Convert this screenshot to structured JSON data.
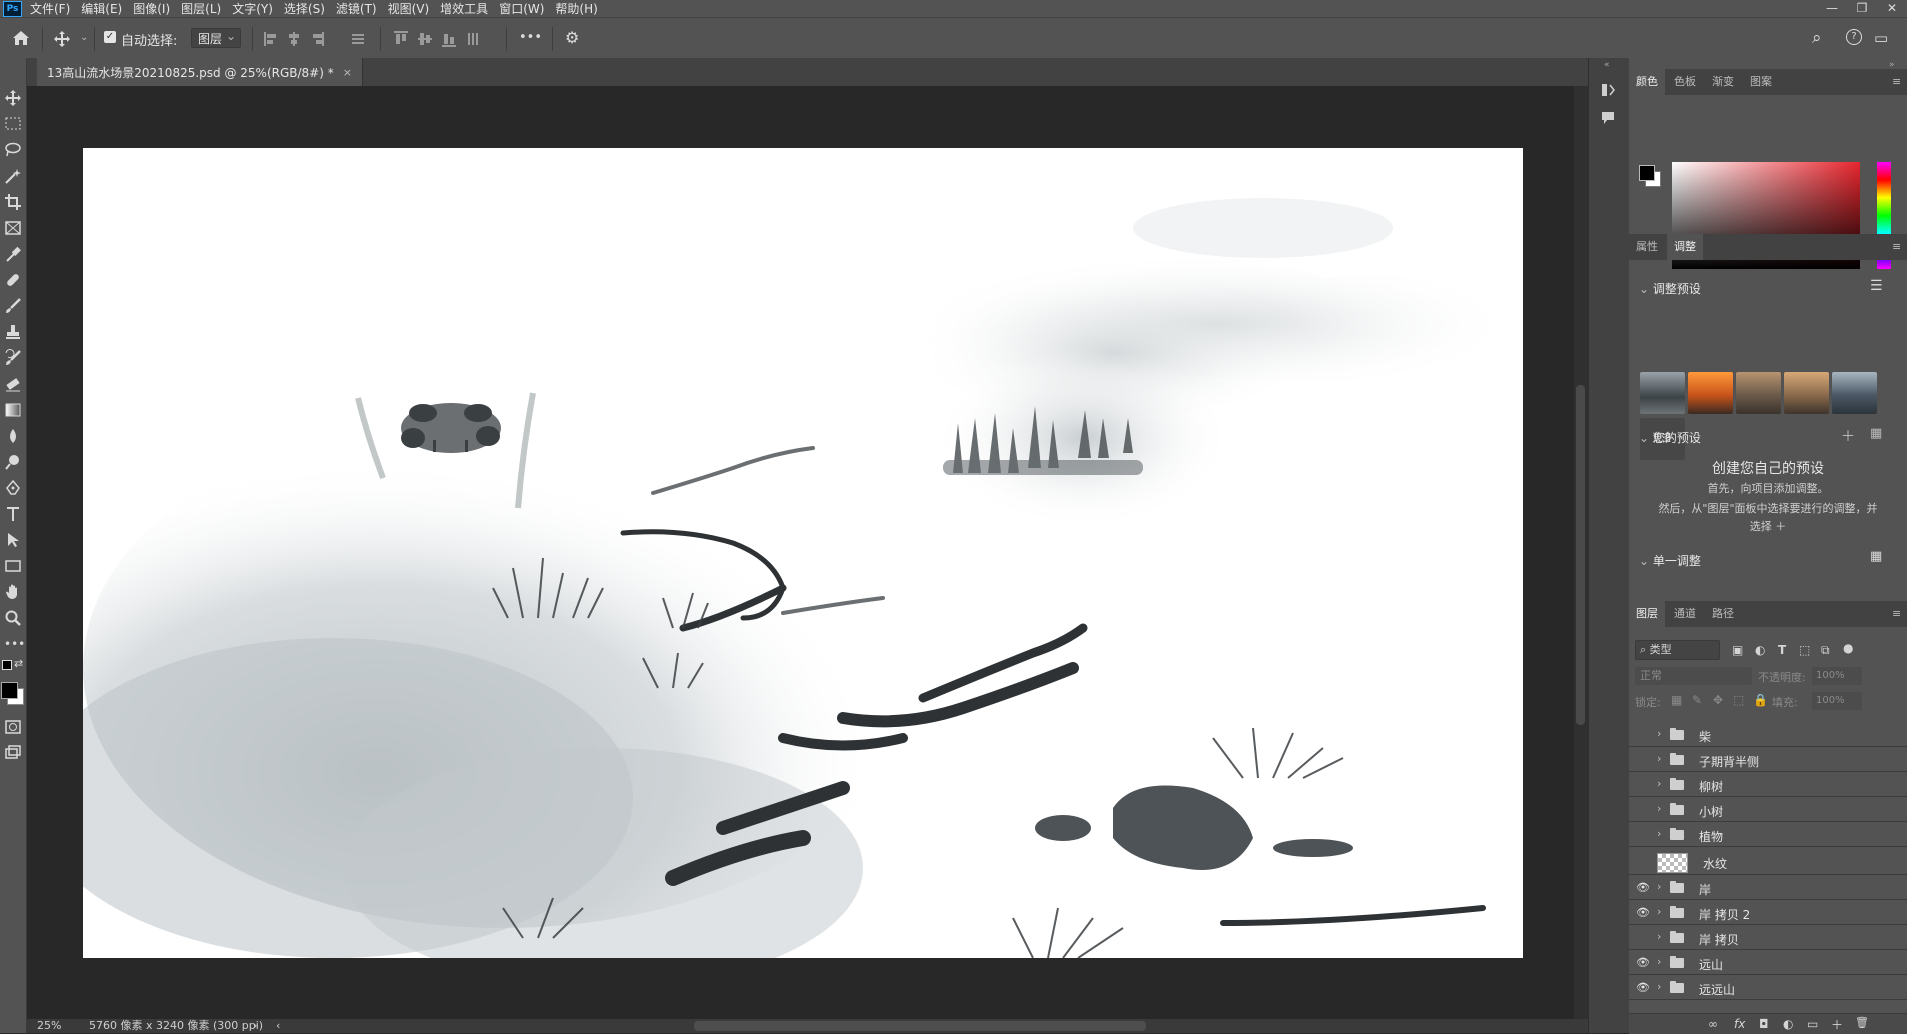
{
  "app": {
    "logo": "Ps"
  },
  "menu": [
    "文件(F)",
    "编辑(E)",
    "图像(I)",
    "图层(L)",
    "文字(Y)",
    "选择(S)",
    "滤镜(T)",
    "视图(V)",
    "增效工具",
    "窗口(W)",
    "帮助(H)"
  ],
  "window_controls": {
    "minimize": "—",
    "restore": "❐",
    "close": "✕"
  },
  "options": {
    "home_icon": "home-icon",
    "move_icon": "move-icon",
    "auto_select_label": "自动选择:",
    "auto_select_checked": true,
    "auto_select_check": "✓",
    "layer_mode": "图层",
    "more": "•••",
    "gear": "⚙",
    "search": "⌕",
    "help": "?",
    "workspace": "▭"
  },
  "document_tab": {
    "title": "13高山流水场景20210825.psd @ 25%(RGB/8#) *",
    "close": "×"
  },
  "status": {
    "zoom": "25%",
    "info": "5760 像素 x 3240 像素 (300 ppi)",
    "arrow": "›",
    "left_arrow": "‹"
  },
  "color_panel": {
    "tabs": [
      "颜色",
      "色板",
      "渐变",
      "图案"
    ],
    "active_tab": "颜色",
    "foreground": "#000000",
    "background": "#ffffff",
    "hue_color": "#e8262e"
  },
  "adjust_panel": {
    "tabs": [
      "属性",
      "调整"
    ],
    "active_tab": "调整",
    "presets_header": "调整预设",
    "more_label": "更多",
    "your_presets_header": "您的预设",
    "create_title": "创建您自己的预设",
    "create_line1": "首先，向项目添加调整。",
    "create_line2": "然后，从\"图层\"面板中选择要进行的调整，并",
    "create_line3": "选择 ＋",
    "single_header": "单一调整"
  },
  "layers_panel": {
    "tabs": [
      "图层",
      "通道",
      "路径"
    ],
    "active_tab": "图层",
    "filter_label": "类型",
    "blend_mode": "正常",
    "opacity_label": "不透明度:",
    "opacity_value": "100%",
    "lock_label": "锁定:",
    "fill_label": "填充:",
    "fill_value": "100%",
    "layers": [
      {
        "name": "柴",
        "visible": false,
        "type": "group"
      },
      {
        "name": "子期背半侧",
        "visible": false,
        "type": "group"
      },
      {
        "name": "柳树",
        "visible": false,
        "type": "group"
      },
      {
        "name": "小树",
        "visible": false,
        "type": "group"
      },
      {
        "name": "植物",
        "visible": false,
        "type": "group"
      },
      {
        "name": "水纹",
        "visible": false,
        "type": "layer"
      },
      {
        "name": "岸",
        "visible": true,
        "type": "group"
      },
      {
        "name": "岸 拷贝 2",
        "visible": true,
        "type": "group"
      },
      {
        "name": "岸 拷贝",
        "visible": false,
        "type": "group"
      },
      {
        "name": "远山",
        "visible": true,
        "type": "group"
      },
      {
        "name": "远远山",
        "visible": true,
        "type": "group"
      }
    ],
    "footer_icons": [
      "∞",
      "fx",
      "◘",
      "◐",
      "▭",
      "＋",
      "🗑"
    ]
  },
  "tools": [
    "move-tool",
    "marquee-tool",
    "lasso-tool",
    "magic-wand-tool",
    "crop-tool",
    "frame-tool",
    "eyedropper-tool",
    "healing-tool",
    "brush-tool",
    "stamp-tool",
    "history-brush-tool",
    "eraser-tool",
    "gradient-tool",
    "blur-tool",
    "dodge-tool",
    "pen-tool",
    "type-tool",
    "path-select-tool",
    "shape-tool",
    "hand-tool",
    "zoom-tool",
    "more-tools"
  ]
}
